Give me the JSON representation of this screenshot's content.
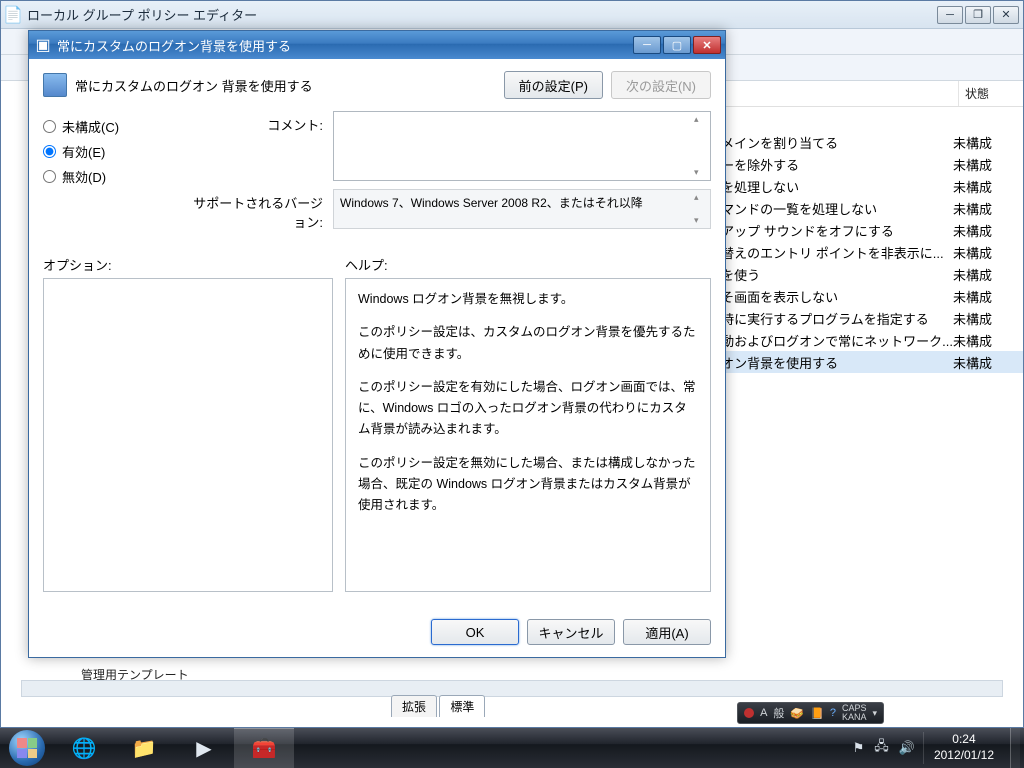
{
  "parent": {
    "title": "ローカル グループ ポリシー エディター",
    "tree_item": "管理用テンプレート",
    "tabs": {
      "extended": "拡張",
      "standard": "標準"
    },
    "list_header": {
      "col2": "状態"
    },
    "status_value": "未構成",
    "rows": [
      "メインを割り当てる",
      "ーを除外する",
      "を処理しない",
      "マンドの一覧を処理しない",
      "アップ サウンドをオフにする",
      "替えのエントリ ポイントを非表示に...",
      "を使う",
      "そ画面を表示しない",
      "時に実行するプログラムを指定する",
      "動およびログオンで常にネットワーク...",
      "オン背景を使用する"
    ]
  },
  "dialog": {
    "title": "常にカスタムのログオン背景を使用する",
    "policy_name": "常にカスタムのログオン 背景を使用する",
    "prev_btn": "前の設定(P)",
    "next_btn": "次の設定(N)",
    "radio_notconfig": "未構成(C)",
    "radio_enabled": "有効(E)",
    "radio_disabled": "無効(D)",
    "comment_label": "コメント:",
    "support_label": "サポートされるバージョン:",
    "support_text": "Windows 7、Windows Server 2008 R2、またはそれ以降",
    "options_label": "オプション:",
    "help_label": "ヘルプ:",
    "help_p1": "Windows ログオン背景を無視します。",
    "help_p2": "このポリシー設定は、カスタムのログオン背景を優先するために使用できます。",
    "help_p3": "このポリシー設定を有効にした場合、ログオン画面では、常に、Windows ロゴの入ったログオン背景の代わりにカスタム背景が読み込まれます。",
    "help_p4": "このポリシー設定を無効にした場合、または構成しなかった場合、既定の Windows ログオン背景またはカスタム背景が使用されます。",
    "ok": "OK",
    "cancel": "キャンセル",
    "apply": "適用(A)"
  },
  "taskbar": {
    "time": "0:24",
    "date": "2012/01/12",
    "ime_a": "A",
    "ime_han": "般",
    "caps": "CAPS",
    "kana": "KANA"
  }
}
